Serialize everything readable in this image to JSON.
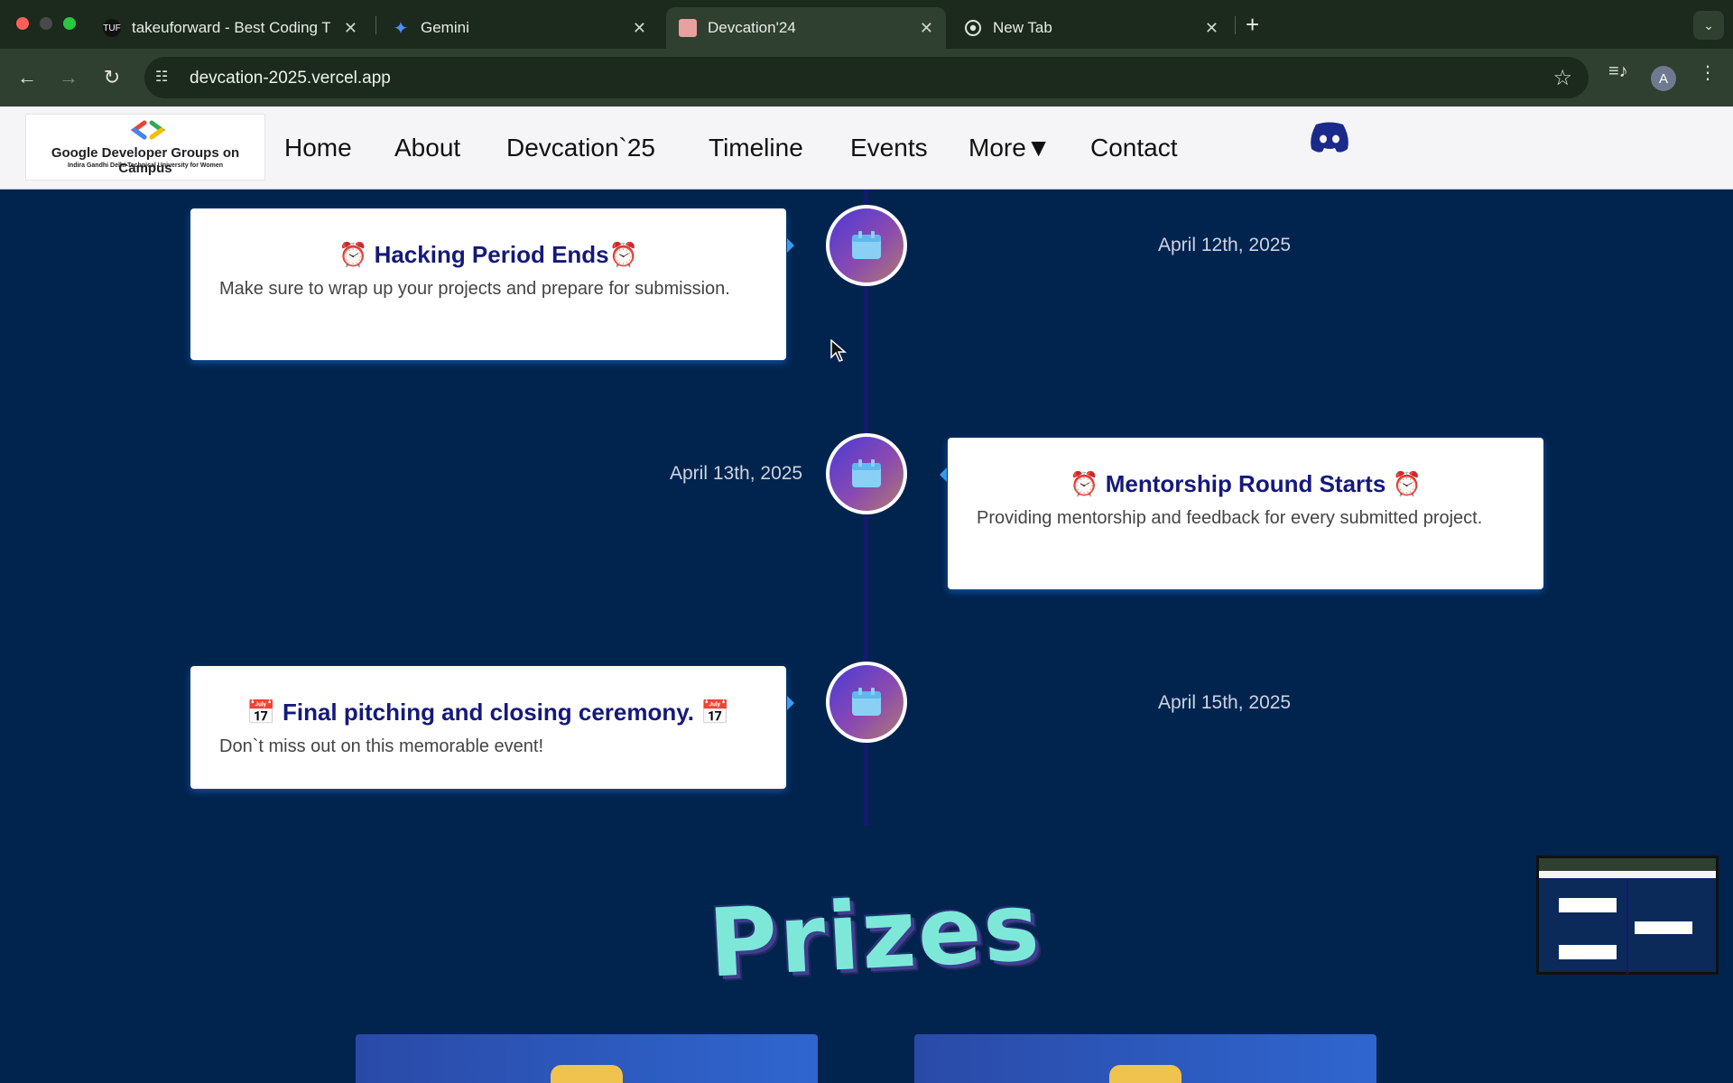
{
  "browser": {
    "tabs": [
      {
        "title": "takeuforward - Best Coding T",
        "icon": "tuf-favicon",
        "favicon_text": "TUF"
      },
      {
        "title": "Gemini",
        "icon": "gemini-sparkle-icon"
      },
      {
        "title": "Devcation'24",
        "icon": "devcation-favicon",
        "active": true
      },
      {
        "title": "New Tab",
        "icon": "chrome-icon"
      }
    ],
    "url": "devcation-2025.vercel.app",
    "profile_initial": "A"
  },
  "site": {
    "logo_line1": "Google Developer Groups on Campus",
    "logo_line2": "Indira Gandhi Delhi Technical University for Women",
    "nav": [
      "Home",
      "About",
      "Devcation`25",
      "Timeline",
      "Events",
      "More▼",
      "Contact"
    ]
  },
  "timeline": [
    {
      "side": "left",
      "title": "⏰ Hacking Period Ends⏰",
      "desc": "Make sure to wrap up your projects and prepare for submission.",
      "date": "April 12th, 2025"
    },
    {
      "side": "right",
      "title": "⏰ Mentorship Round Starts ⏰",
      "desc": "Providing mentorship and feedback for every submitted project.",
      "date": "April 13th, 2025"
    },
    {
      "side": "left",
      "title": "📅 Final pitching and closing ceremony. 📅",
      "desc": "Don`t miss out on this memorable event!",
      "date": "April 15th, 2025"
    }
  ],
  "prizes_heading": "Prizes",
  "colors": {
    "page_bg": "#01244f",
    "card_title": "#15197a",
    "accent": "#3a9cf0"
  }
}
